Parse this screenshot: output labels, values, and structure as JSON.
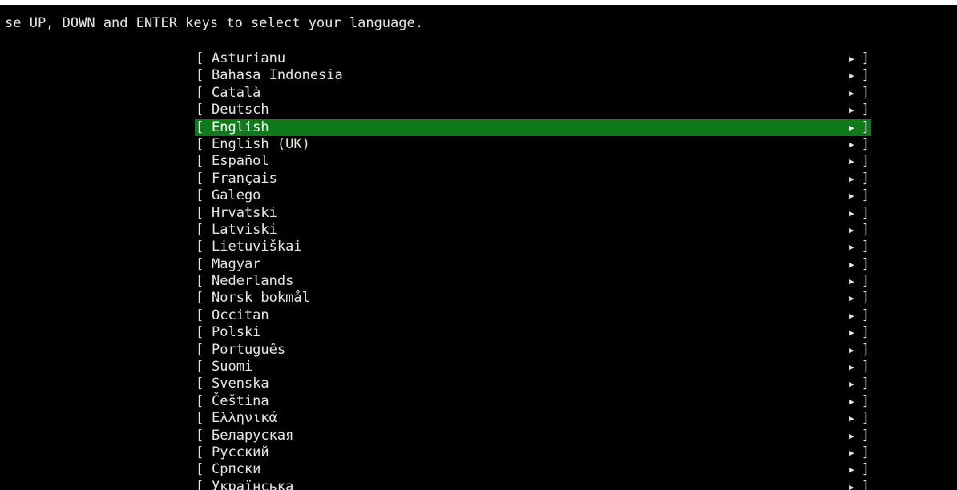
{
  "instruction": "se UP, DOWN and ENTER keys to select your language.",
  "glyphs": {
    "open_bracket": "[",
    "close_bracket": "]",
    "arrow": "▶"
  },
  "selected_language": "English",
  "colors": {
    "background": "#000000",
    "text": "#e6e6e6",
    "selection": "#0f7a1c"
  },
  "languages": [
    {
      "label": "Asturianu"
    },
    {
      "label": "Bahasa Indonesia"
    },
    {
      "label": "Català"
    },
    {
      "label": "Deutsch"
    },
    {
      "label": "English"
    },
    {
      "label": "English (UK)"
    },
    {
      "label": "Español"
    },
    {
      "label": "Français"
    },
    {
      "label": "Galego"
    },
    {
      "label": "Hrvatski"
    },
    {
      "label": "Latviski"
    },
    {
      "label": "Lietuviškai"
    },
    {
      "label": "Magyar"
    },
    {
      "label": "Nederlands"
    },
    {
      "label": "Norsk bokmål"
    },
    {
      "label": "Occitan"
    },
    {
      "label": "Polski"
    },
    {
      "label": "Português"
    },
    {
      "label": "Suomi"
    },
    {
      "label": "Svenska"
    },
    {
      "label": "Čeština"
    },
    {
      "label": "Ελληνικά"
    },
    {
      "label": "Беларуская"
    },
    {
      "label": "Русский"
    },
    {
      "label": "Српски"
    },
    {
      "label": "Українська"
    }
  ]
}
